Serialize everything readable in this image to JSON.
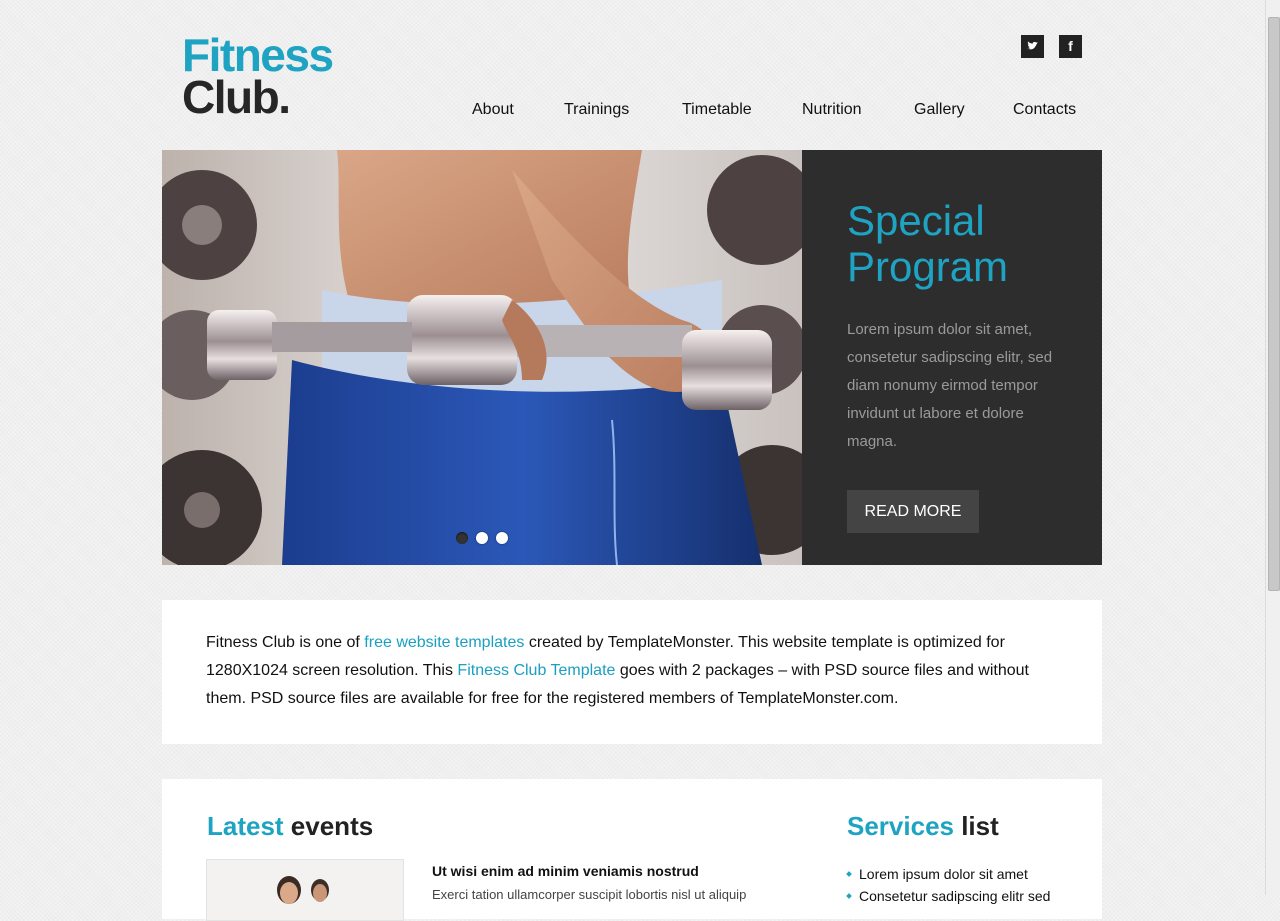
{
  "header": {
    "logo_line1": "Fitness",
    "logo_line2": "Club."
  },
  "social": {
    "twitter_icon": "twitter-icon",
    "facebook_icon": "facebook-icon",
    "facebook_glyph": "f"
  },
  "nav": {
    "items": [
      {
        "label": "About"
      },
      {
        "label": "Trainings"
      },
      {
        "label": "Timetable"
      },
      {
        "label": "Nutrition"
      },
      {
        "label": "Gallery"
      },
      {
        "label": "Contacts"
      }
    ]
  },
  "slider": {
    "title": "Special Program",
    "text": "Lorem ipsum dolor sit amet, consetetur sadipscing elitr, sed diam nonumy eirmod tempor invidunt ut labore et dolore magna.",
    "button": "READ MORE",
    "active_slide": 1,
    "slide_count": 3
  },
  "intro": {
    "p1": "Fitness Club is one of ",
    "link1": "free website templates",
    "p2": " created by TemplateMonster. This website template is optimized for 1280X1024 screen resolution. This ",
    "link2": "Fitness Club Template",
    "p3": " goes with 2 packages – with PSD source files and without them. PSD source files are available for free for the registered members of TemplateMonster.com."
  },
  "events": {
    "title_accent": "Latest",
    "title_rest": " events",
    "item_title": "Ut wisi enim ad minim veniamis nostrud",
    "item_text": "Exerci tation ullamcorper suscipit lobortis nisl ut aliquip"
  },
  "services": {
    "title_accent": "Services",
    "title_rest": " list",
    "items": [
      "Lorem ipsum dolor sit amet",
      "Consetetur sadipscing elitr sed"
    ]
  },
  "colors": {
    "accent": "#1ea3c2",
    "dark": "#2d2d2d",
    "background": "#efefef"
  }
}
